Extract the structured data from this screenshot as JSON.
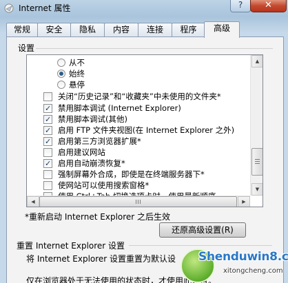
{
  "window": {
    "title": "Internet 属性",
    "help_label": "?",
    "close_label": "✕"
  },
  "tabs": [
    {
      "label": "常规"
    },
    {
      "label": "安全"
    },
    {
      "label": "隐私"
    },
    {
      "label": "内容"
    },
    {
      "label": "连接"
    },
    {
      "label": "程序"
    },
    {
      "label": "高级",
      "active": true
    }
  ],
  "settings": {
    "section_label": "设置",
    "items": [
      {
        "kind": "radio",
        "checked": false,
        "label": "从不"
      },
      {
        "kind": "radio",
        "checked": true,
        "label": "始终"
      },
      {
        "kind": "radio",
        "checked": false,
        "label": "悬停"
      },
      {
        "kind": "checkbox",
        "checked": false,
        "label": "关闭“历史记录”和“收藏夹”中未使用的文件夹*"
      },
      {
        "kind": "checkbox",
        "checked": true,
        "label": "禁用脚本调试 (Internet Explorer)"
      },
      {
        "kind": "checkbox",
        "checked": true,
        "label": "禁用脚本调试(其他)"
      },
      {
        "kind": "checkbox",
        "checked": true,
        "label": "启用 FTP 文件夹视图(在 Internet Explorer 之外)"
      },
      {
        "kind": "checkbox",
        "checked": true,
        "label": "启用第三方浏览器扩展*"
      },
      {
        "kind": "checkbox",
        "checked": false,
        "label": "启用建议网站"
      },
      {
        "kind": "checkbox",
        "checked": true,
        "label": "启用自动崩溃恢复*"
      },
      {
        "kind": "checkbox",
        "checked": false,
        "label": "强制屏幕外合成，即使是在终端服务器下*"
      },
      {
        "kind": "checkbox",
        "checked": false,
        "label": "使网站可以使用搜索窗格*"
      },
      {
        "kind": "checkbox",
        "checked": false,
        "label": "使用 Ctrl+Tab 切换选项卡时，使用最新顺序"
      }
    ],
    "restart_note": "*重新启动 Internet Explorer 之后生效",
    "restore_button": "还原高级设置(R)"
  },
  "reset": {
    "title": "重置 Internet Explorer 设置",
    "description": "将 Internet Explorer 设置重置为默认设",
    "warning": "仅在浏览器处于无法使用的状态时，才使用此设置。"
  },
  "watermark": {
    "text": "Shenduwin8.com",
    "subtext": "xitongcheng.com"
  }
}
